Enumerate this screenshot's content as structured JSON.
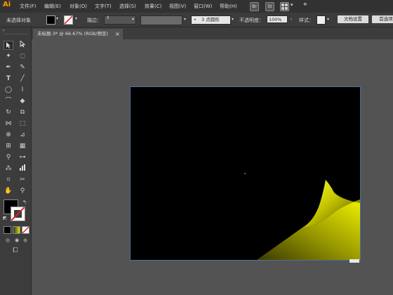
{
  "app": {
    "logo": "Ai"
  },
  "menu": [
    "文件(F)",
    "编辑(E)",
    "对象(O)",
    "文字(T)",
    "选择(S)",
    "效果(C)",
    "视图(V)",
    "窗口(W)",
    "帮助(H)"
  ],
  "menu_icons": [
    "Br",
    "St"
  ],
  "control": {
    "selection_label": "未选择对象",
    "stroke_label": "描边：",
    "brush_value": "3 点圆形",
    "opacity_label": "不透明度：",
    "opacity_value": "100%",
    "style_label": "样式：",
    "doc_setup_label": "文档设置",
    "prefs_label": "首选项"
  },
  "document_tab": {
    "title": "未标题-3* @ 66.67% (RGB/预览)",
    "close_glyph": "×"
  },
  "colors": {
    "app_bg": "#535353",
    "panel_bg": "#3c3c3c",
    "menubar_bg": "#323232",
    "artboard_fill": "#000000",
    "page_curl_yellow": "#e6e600",
    "accent_logo": "#ff9a00"
  },
  "icons": {
    "toolbar": [
      "selection-tool-icon",
      "direct-selection-tool-icon",
      "magic-wand-tool-icon",
      "lasso-tool-icon",
      "pen-tool-icon",
      "curvature-tool-icon",
      "type-tool-icon",
      "line-segment-tool-icon",
      "ellipse-tool-icon",
      "paintbrush-tool-icon",
      "shaper-tool-icon",
      "eraser-tool-icon",
      "rotate-tool-icon",
      "scale-tool-icon",
      "width-tool-icon",
      "free-transform-tool-icon",
      "shape-builder-tool-icon",
      "perspective-grid-tool-icon",
      "mesh-tool-icon",
      "gradient-tool-icon",
      "eyedropper-tool-icon",
      "blend-tool-icon",
      "symbol-sprayer-tool-icon",
      "column-graph-tool-icon",
      "artboard-tool-icon",
      "slice-tool-icon",
      "hand-tool-icon",
      "zoom-tool-icon"
    ]
  }
}
